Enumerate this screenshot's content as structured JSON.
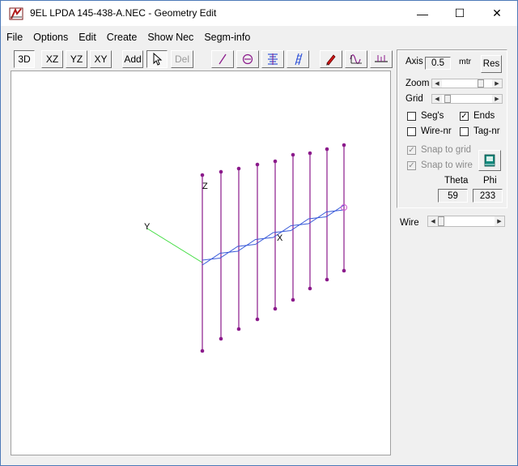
{
  "window": {
    "title": "9EL LPDA 145-438-A.NEC - Geometry Edit",
    "minimize": "—",
    "maximize": "☐",
    "close": "✕"
  },
  "menu": [
    "File",
    "Options",
    "Edit",
    "Create",
    "Show Nec",
    "Segm-info"
  ],
  "toolbar": {
    "view_3d": "3D",
    "view_xz": "XZ",
    "view_yz": "YZ",
    "view_xy": "XY",
    "add": "Add",
    "del": "Del"
  },
  "panel": {
    "axis_label": "Axis",
    "axis_value": "0.5",
    "axis_unit": "mtr",
    "res_button": "Res",
    "zoom_label": "Zoom",
    "grid_label": "Grid",
    "segs_label": "Seg's",
    "segs_checked": false,
    "ends_label": "Ends",
    "ends_checked": true,
    "wirenr_label": "Wire-nr",
    "wirenr_checked": false,
    "tagnr_label": "Tag-nr",
    "tagnr_checked": false,
    "snap_grid_label": "Snap to grid",
    "snap_grid_checked": true,
    "snap_wire_label": "Snap to wire",
    "snap_wire_checked": true,
    "theta_label": "Theta",
    "theta_value": "59",
    "phi_label": "Phi",
    "phi_value": "233",
    "zoom_level": 0.82,
    "grid_level": 0.05
  },
  "wire_label": "Wire",
  "wire_level": 0.0,
  "canvas": {
    "axis_z": "Z",
    "axis_y": "Y",
    "axis_x": "X"
  },
  "colors": {
    "element": "#8b1a8b",
    "boom": "#3a5bd9",
    "y_axis": "#3ddc3d"
  }
}
